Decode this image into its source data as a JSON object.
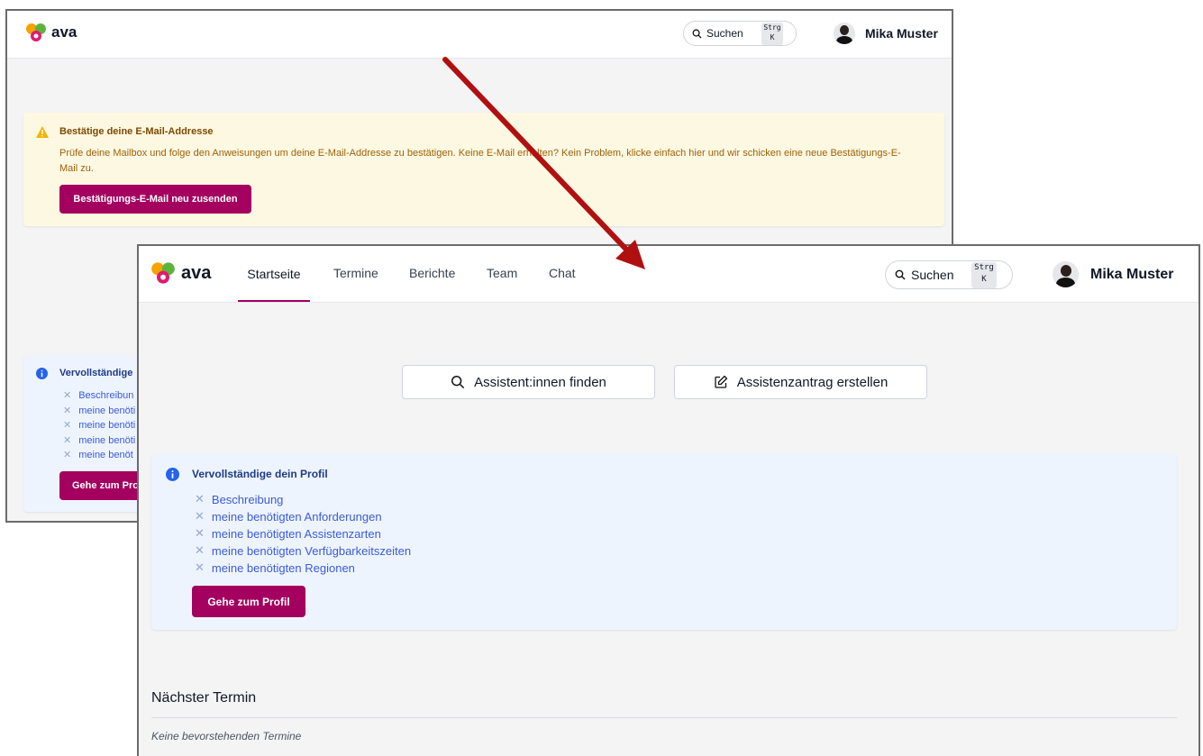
{
  "app": {
    "logo_text": "ava",
    "search_label": "Suchen",
    "search_kbd_top": "Strg",
    "search_kbd_bottom": "K",
    "user_name": "Mika Muster"
  },
  "nav": {
    "tabs": [
      {
        "label": "Startseite",
        "active": true
      },
      {
        "label": "Termine",
        "active": false
      },
      {
        "label": "Berichte",
        "active": false
      },
      {
        "label": "Team",
        "active": false
      },
      {
        "label": "Chat",
        "active": false
      }
    ]
  },
  "before": {
    "warning": {
      "title": "Bestätige deine E-Mail-Addresse",
      "text": "Prüfe deine Mailbox und folge den Anweisungen um deine E-Mail-Addresse zu bestätigen. Keine E-Mail erhalten? Kein Problem, klicke einfach hier und wir schicken eine neue Bestätigungs-E-Mail zu.",
      "button": "Bestätigungs-E-Mail neu zusenden"
    },
    "profile_box": {
      "title": "Vervollständige",
      "items": [
        "Beschreibun",
        "meine benöti",
        "meine benöti",
        "meine benöti",
        "meine benöt"
      ],
      "button": "Gehe zum Pro"
    }
  },
  "after": {
    "actions": {
      "find": "Assistent:innen finden",
      "create": "Assistenzantrag erstellen"
    },
    "profile_box": {
      "title": "Vervollständige dein Profil",
      "items": [
        "Beschreibung",
        "meine benötigten Anforderungen",
        "meine benötigten Assistenzarten",
        "meine benötigten Verfügbarkeitszeiten",
        "meine benötigten Regionen"
      ],
      "button": "Gehe zum Profil"
    },
    "next_appointment": {
      "heading": "Nächster Termin",
      "empty": "Keine bevorstehenden Termine"
    }
  },
  "colors": {
    "brand": "#a3005f",
    "arrow": "#b01010",
    "warning_bg": "#fdf8e1",
    "info_bg": "#eef4fd"
  },
  "icons": {
    "warning": "warning-triangle-icon",
    "info": "info-circle-icon",
    "search": "search-icon",
    "edit": "edit-icon",
    "close": "x-icon"
  }
}
